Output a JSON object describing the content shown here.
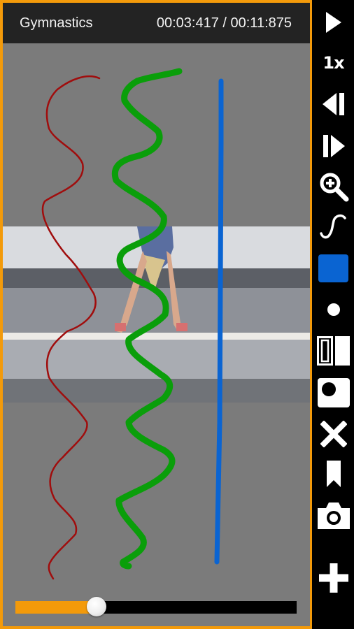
{
  "header": {
    "title": "Gymnastics",
    "time_current": "00:03:417",
    "time_total": "00:11:875",
    "time_separator": " / "
  },
  "playback": {
    "progress_fraction": 0.2877,
    "speed_label": "1x"
  },
  "colors": {
    "accent": "#f39a0a",
    "stage_bg": "#7b7b7b",
    "header_bg": "#232323",
    "toolbar_bg": "#000000",
    "selected_color": "#0a64d2",
    "stroke_red": "#a00d0d",
    "stroke_green": "#0a9e0a",
    "stroke_blue": "#0a64d2"
  },
  "annotations": [
    {
      "name": "red-wave-stroke",
      "color": "#a00d0d",
      "width": "thin"
    },
    {
      "name": "green-wave-stroke",
      "color": "#0a9e0a",
      "width": "thick"
    },
    {
      "name": "blue-line-stroke",
      "color": "#0a64d2",
      "width": "medium"
    }
  ],
  "toolbar": {
    "items": [
      {
        "id": "play",
        "icon": "play-icon"
      },
      {
        "id": "speed",
        "icon": "speed-label"
      },
      {
        "id": "step-back",
        "icon": "step-back-icon"
      },
      {
        "id": "step-forward",
        "icon": "step-forward-icon"
      },
      {
        "id": "zoom",
        "icon": "zoom-in-icon"
      },
      {
        "id": "freehand",
        "icon": "freehand-icon"
      },
      {
        "id": "color",
        "icon": "color-swatch"
      },
      {
        "id": "stroke-size",
        "icon": "dot-icon"
      },
      {
        "id": "split-view",
        "icon": "split-view-icon"
      },
      {
        "id": "overlay",
        "icon": "overlay-icon"
      },
      {
        "id": "clear",
        "icon": "close-icon"
      },
      {
        "id": "bookmark",
        "icon": "bookmark-icon"
      },
      {
        "id": "snapshot",
        "icon": "camera-icon"
      },
      {
        "id": "add",
        "icon": "plus-icon"
      }
    ]
  }
}
